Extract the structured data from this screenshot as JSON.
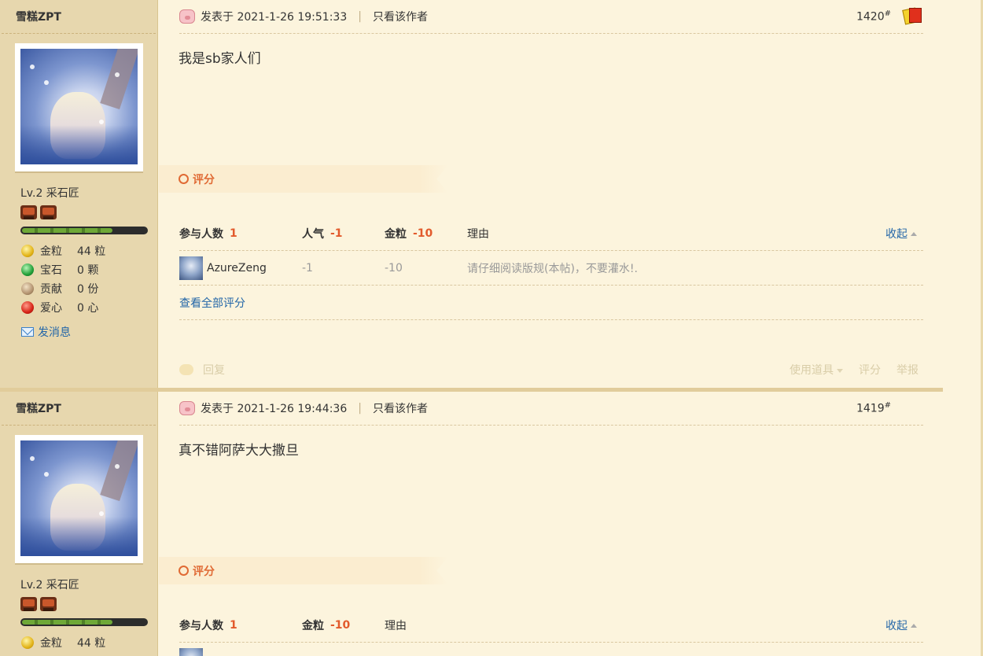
{
  "posts": [
    {
      "author": {
        "name": "雪糕ZPT",
        "level": "Lv.2 采石匠",
        "stats": [
          {
            "label": "金粒",
            "value": "44 粒",
            "icon": "gold-coin-icon"
          },
          {
            "label": "宝石",
            "value": "0 颗",
            "icon": "gem-icon"
          },
          {
            "label": "贡献",
            "value": "0 份",
            "icon": "contribution-icon"
          },
          {
            "label": "爱心",
            "value": "0 心",
            "icon": "heart-icon"
          }
        ],
        "send_message": "发消息"
      },
      "meta": {
        "posted_label": "发表于 2021-1-26 19:51:33",
        "separator": "|",
        "only_author": "只看该作者"
      },
      "floor": "1420",
      "floor_mark": "#",
      "content": "我是sb家人们",
      "rating": {
        "label": "评分",
        "headers": {
          "participants": "参与人数",
          "participants_count": "1",
          "popularity": "人气",
          "popularity_value": "-1",
          "gold": "金粒",
          "gold_value": "-10",
          "reason": "理由",
          "collapse": "收起"
        },
        "rows": [
          {
            "user": "AzureZeng",
            "popularity": "-1",
            "gold": "-10",
            "reason": "请仔细阅读版规(本帖)，不要灌水!."
          }
        ],
        "view_all": "查看全部评分"
      },
      "actions": {
        "reply": "回复",
        "use_tool": "使用道具",
        "rate": "评分",
        "report": "举报"
      }
    },
    {
      "author": {
        "name": "雪糕ZPT",
        "level": "Lv.2 采石匠",
        "stats": [
          {
            "label": "金粒",
            "value": "44 粒",
            "icon": "gold-coin-icon"
          }
        ]
      },
      "meta": {
        "posted_label": "发表于 2021-1-26 19:44:36",
        "separator": "|",
        "only_author": "只看该作者"
      },
      "floor": "1419",
      "floor_mark": "#",
      "content": "真不错阿萨大大撒旦",
      "rating": {
        "label": "评分",
        "headers": {
          "participants": "参与人数",
          "participants_count": "1",
          "gold": "金粒",
          "gold_value": "-10",
          "reason": "理由",
          "collapse": "收起"
        }
      }
    }
  ],
  "colors": {
    "background": "#fcf4dd",
    "sidebar": "#e7d7ae",
    "accent": "#e25a2c",
    "link": "#2366a8"
  }
}
